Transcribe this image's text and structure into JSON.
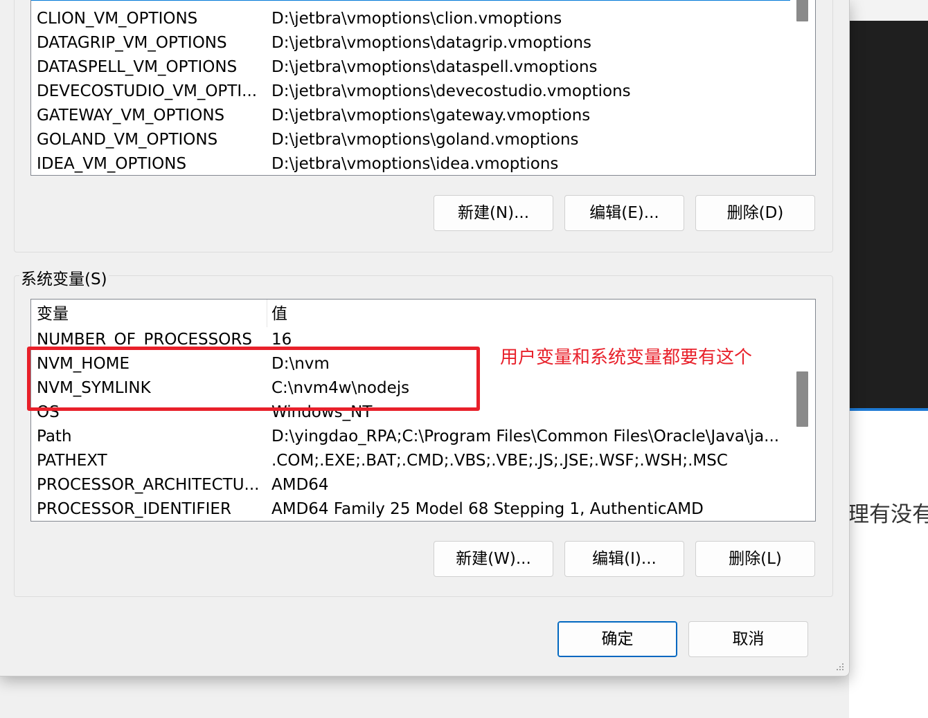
{
  "background": {
    "partial_text": "理有没有这"
  },
  "user_vars": {
    "rows": [
      {
        "name": "CLION_VM_OPTIONS",
        "value": "D:\\jetbra\\vmoptions\\clion.vmoptions"
      },
      {
        "name": "DATAGRIP_VM_OPTIONS",
        "value": "D:\\jetbra\\vmoptions\\datagrip.vmoptions"
      },
      {
        "name": "DATASPELL_VM_OPTIONS",
        "value": "D:\\jetbra\\vmoptions\\dataspell.vmoptions"
      },
      {
        "name": "DEVECOSTUDIO_VM_OPTI...",
        "value": "D:\\jetbra\\vmoptions\\devecostudio.vmoptions"
      },
      {
        "name": "GATEWAY_VM_OPTIONS",
        "value": "D:\\jetbra\\vmoptions\\gateway.vmoptions"
      },
      {
        "name": "GOLAND_VM_OPTIONS",
        "value": "D:\\jetbra\\vmoptions\\goland.vmoptions"
      },
      {
        "name": "IDEA_VM_OPTIONS",
        "value": "D:\\jetbra\\vmoptions\\idea.vmoptions"
      }
    ],
    "buttons": {
      "new": "新建(N)...",
      "edit": "编辑(E)...",
      "delete": "删除(D)"
    }
  },
  "system_vars": {
    "group_label": "系统变量(S)",
    "header": {
      "name": "变量",
      "value": "值"
    },
    "rows": [
      {
        "name": "NUMBER_OF_PROCESSORS",
        "value": "16"
      },
      {
        "name": "NVM_HOME",
        "value": "D:\\nvm"
      },
      {
        "name": "NVM_SYMLINK",
        "value": "C:\\nvm4w\\nodejs"
      },
      {
        "name": "OS",
        "value": "Windows_NT"
      },
      {
        "name": "Path",
        "value": "D:\\yingdao_RPA;C:\\Program Files\\Common Files\\Oracle\\Java\\ja..."
      },
      {
        "name": "PATHEXT",
        "value": ".COM;.EXE;.BAT;.CMD;.VBS;.VBE;.JS;.JSE;.WSF;.WSH;.MSC"
      },
      {
        "name": "PROCESSOR_ARCHITECTU...",
        "value": "AMD64"
      },
      {
        "name": "PROCESSOR_IDENTIFIER",
        "value": "AMD64 Family 25 Model 68 Stepping 1, AuthenticAMD"
      }
    ],
    "buttons": {
      "new": "新建(W)...",
      "edit": "编辑(I)...",
      "delete": "删除(L)"
    }
  },
  "dialog_buttons": {
    "ok": "确定",
    "cancel": "取消"
  },
  "annotation": {
    "note": "用户变量和系统变量都要有这个",
    "color": "#e8202a"
  },
  "colors": {
    "selection": "#0078d7",
    "primary_border": "#0067c0"
  }
}
